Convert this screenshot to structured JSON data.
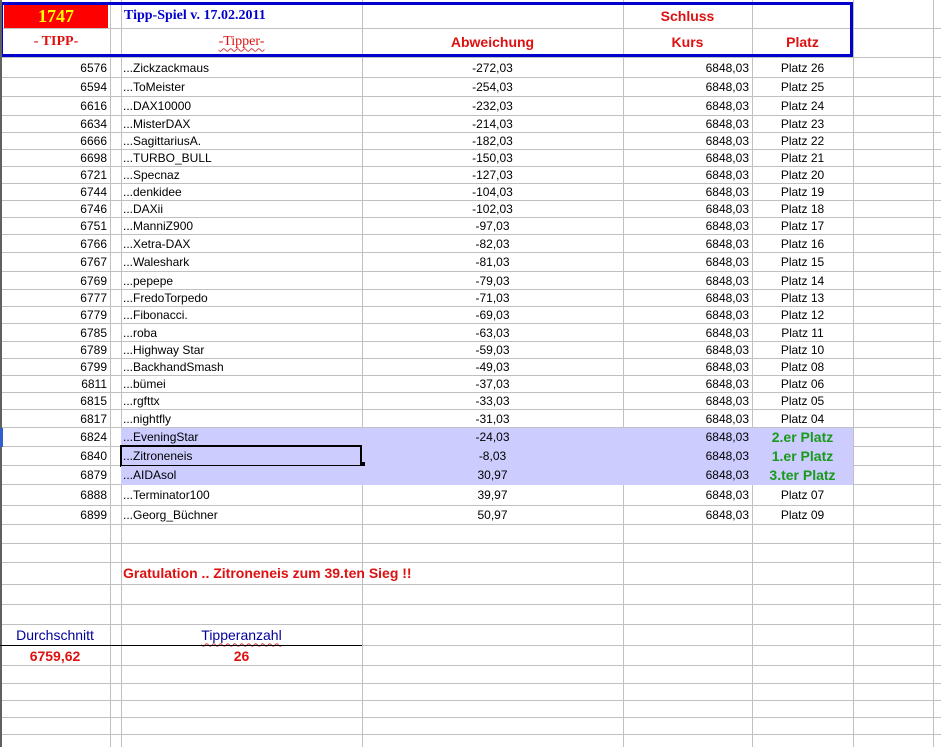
{
  "header": {
    "count": "1747",
    "title": "Tipp-Spiel v. 17.02.2011",
    "tipp_label": "- TIPP-",
    "tipper_label": "-Tipper-",
    "abweichung_label": "Abweichung",
    "schluss_label": "Schluss",
    "kurs_label": "Kurs",
    "platz_label": "Platz"
  },
  "colors": {
    "header_bg": "#ff0000",
    "header_count": "#ffff00",
    "title": "#0000cc",
    "red": "#dd1111",
    "winner": "#1a9a1a",
    "highlight": "#ccccff"
  },
  "rows": [
    {
      "tipp": "6576",
      "tipper": "...Zickzackmaus",
      "abw": "-272,03",
      "kurs": "6848,03",
      "platz": "Platz 26"
    },
    {
      "tipp": "6594",
      "tipper": "...ToMeister",
      "abw": "-254,03",
      "kurs": "6848,03",
      "platz": "Platz 25"
    },
    {
      "tipp": "6616",
      "tipper": "...DAX10000",
      "abw": "-232,03",
      "kurs": "6848,03",
      "platz": "Platz 24"
    },
    {
      "tipp": "6634",
      "tipper": "...MisterDAX",
      "abw": "-214,03",
      "kurs": "6848,03",
      "platz": "Platz 23"
    },
    {
      "tipp": "6666",
      "tipper": "...SagittariusA.",
      "abw": "-182,03",
      "kurs": "6848,03",
      "platz": "Platz 22"
    },
    {
      "tipp": "6698",
      "tipper": "...TURBO_BULL",
      "abw": "-150,03",
      "kurs": "6848,03",
      "platz": "Platz 21"
    },
    {
      "tipp": "6721",
      "tipper": "...Specnaz",
      "abw": "-127,03",
      "kurs": "6848,03",
      "platz": "Platz 20"
    },
    {
      "tipp": "6744",
      "tipper": "...denkidee",
      "abw": "-104,03",
      "kurs": "6848,03",
      "platz": "Platz 19"
    },
    {
      "tipp": "6746",
      "tipper": "...DAXii",
      "abw": "-102,03",
      "kurs": "6848,03",
      "platz": "Platz 18"
    },
    {
      "tipp": "6751",
      "tipper": "...ManniZ900",
      "abw": "-97,03",
      "kurs": "6848,03",
      "platz": "Platz 17"
    },
    {
      "tipp": "6766",
      "tipper": "...Xetra-DAX",
      "abw": "-82,03",
      "kurs": "6848,03",
      "platz": "Platz 16"
    },
    {
      "tipp": "6767",
      "tipper": "...Waleshark",
      "abw": "-81,03",
      "kurs": "6848,03",
      "platz": "Platz 15"
    },
    {
      "tipp": "6769",
      "tipper": "...pepepe",
      "abw": "-79,03",
      "kurs": "6848,03",
      "platz": "Platz 14"
    },
    {
      "tipp": "6777",
      "tipper": "...FredoTorpedo",
      "abw": "-71,03",
      "kurs": "6848,03",
      "platz": "Platz 13"
    },
    {
      "tipp": "6779",
      "tipper": "...Fibonacci.",
      "abw": "-69,03",
      "kurs": "6848,03",
      "platz": "Platz 12"
    },
    {
      "tipp": "6785",
      "tipper": "...roba",
      "abw": "-63,03",
      "kurs": "6848,03",
      "platz": "Platz 11"
    },
    {
      "tipp": "6789",
      "tipper": "...Highway Star",
      "abw": "-59,03",
      "kurs": "6848,03",
      "platz": "Platz 10"
    },
    {
      "tipp": "6799",
      "tipper": "...BackhandSmash",
      "abw": "-49,03",
      "kurs": "6848,03",
      "platz": "Platz 08"
    },
    {
      "tipp": "6811",
      "tipper": "...bümei",
      "abw": "-37,03",
      "kurs": "6848,03",
      "platz": "Platz 06"
    },
    {
      "tipp": "6815",
      "tipper": "...rgfttx",
      "abw": "-33,03",
      "kurs": "6848,03",
      "platz": "Platz 05"
    },
    {
      "tipp": "6817",
      "tipper": "...nightfly",
      "abw": "-31,03",
      "kurs": "6848,03",
      "platz": "Platz 04"
    },
    {
      "tipp": "6824",
      "tipper": "...EveningStar",
      "abw": "-24,03",
      "kurs": "6848,03",
      "platz": "2.er Platz",
      "winner": true
    },
    {
      "tipp": "6840",
      "tipper": "...Zitroneneis",
      "abw": "-8,03",
      "kurs": "6848,03",
      "platz": "1.er Platz",
      "winner": true,
      "selected": true
    },
    {
      "tipp": "6879",
      "tipper": "...AIDAsol",
      "abw": "30,97",
      "kurs": "6848,03",
      "platz": "3.ter Platz",
      "winner": true
    },
    {
      "tipp": "6888",
      "tipper": "...Terminator100",
      "abw": "39,97",
      "kurs": "6848,03",
      "platz": "Platz 07"
    },
    {
      "tipp": "6899",
      "tipper": "...Georg_Büchner",
      "abw": "50,97",
      "kurs": "6848,03",
      "platz": "Platz 09"
    }
  ],
  "footer": {
    "congrats": "Gratulation .. Zitroneneis zum 39.ten Sieg !!",
    "avg_label": "Durchschnitt",
    "avg_value": "6759,62",
    "count_label": "Tipperanzahl",
    "count_value": "26"
  }
}
